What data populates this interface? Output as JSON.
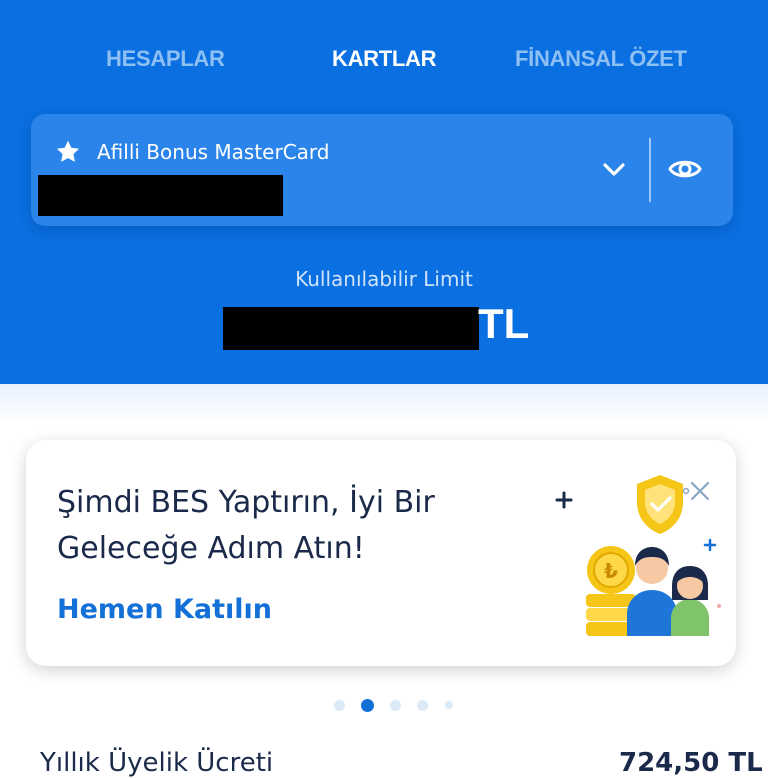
{
  "tabs": [
    {
      "label": "HESAPLAR",
      "active": false
    },
    {
      "label": "KARTLAR",
      "active": true
    },
    {
      "label": "FİNANSAL ÖZET",
      "active": false
    }
  ],
  "card_selector": {
    "card_name": "Afilli Bonus MasterCard",
    "icons": [
      "star-icon",
      "chevron-down-icon",
      "eye-icon"
    ]
  },
  "limit": {
    "label": "Kullanılabilir Limit",
    "currency": "TL"
  },
  "promo": {
    "title": "Şimdi BES Yaptırın, İyi Bir Geleceğe Adım Atın!",
    "link": "Hemen Katılın",
    "icons": [
      "close-icon",
      "shield-check-icon",
      "coin-icon",
      "people-icon"
    ]
  },
  "carousel": {
    "count": 5,
    "active_index": 1
  },
  "fee_row": {
    "label": "Yıllık Üyelik Ücreti",
    "value": "724,50 TL"
  },
  "colors": {
    "header_blue": "#0a6fe0",
    "card_blue": "#2a84ea",
    "link_blue": "#1370d6",
    "text_dark": "#1b2a4a",
    "gold": "#f5c518"
  }
}
